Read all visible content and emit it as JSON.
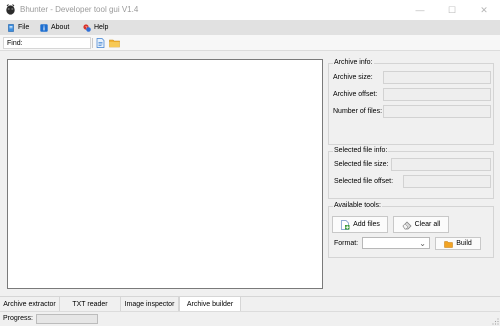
{
  "window": {
    "title": "Bhunter - Developer tool gui V1.4",
    "controls": {
      "minimize": "—",
      "maximize": "☐",
      "close": "✕"
    }
  },
  "menu": {
    "items": [
      {
        "label": "File",
        "icon": "file-icon"
      },
      {
        "label": "About",
        "icon": "info-icon"
      },
      {
        "label": "Help",
        "icon": "help-icon"
      }
    ]
  },
  "find": {
    "label": "Find:",
    "value": "",
    "placeholder": "",
    "buttons": [
      {
        "icon": "document-icon"
      },
      {
        "icon": "folder-icon"
      }
    ]
  },
  "archive_info": {
    "title": "Archive info:",
    "fields": [
      {
        "label": "Archive size:",
        "value": ""
      },
      {
        "label": "Archive offset:",
        "value": ""
      },
      {
        "label": "Number of files:",
        "value": ""
      }
    ]
  },
  "selected_info": {
    "title": "Selected file info:",
    "fields": [
      {
        "label": "Selected file size:",
        "value": ""
      },
      {
        "label": "Selected file offset:",
        "value": ""
      }
    ]
  },
  "tools": {
    "title": "Available tools:",
    "add_files": "Add files",
    "clear_all": "Clear all",
    "format_label": "Format:",
    "format_value": "",
    "build": "Build"
  },
  "tabs": [
    {
      "label": "Archive extractor",
      "active": false
    },
    {
      "label": "TXT reader",
      "active": false
    },
    {
      "label": "Image inspector",
      "active": false
    },
    {
      "label": "Archive builder",
      "active": true
    }
  ],
  "status": {
    "progress_label": "Progress:",
    "progress_value": 0
  },
  "colors": {
    "accent": "#0078d7",
    "progress_fill": "#06b025",
    "folder": "#e8a317"
  }
}
